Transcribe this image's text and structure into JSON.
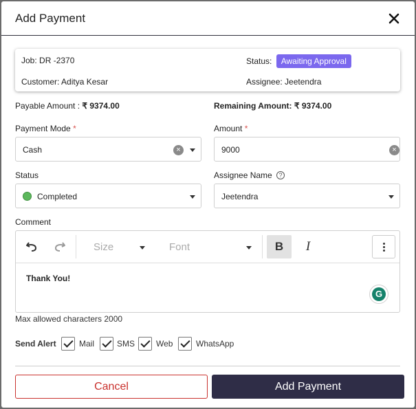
{
  "header": {
    "title": "Add Payment"
  },
  "job": {
    "job_label": "Job:",
    "job_value": "DR -2370",
    "status_label": "Status:",
    "status_value": "Awaiting Approval",
    "customer_label": "Customer:",
    "customer_value": "Aditya Kesar",
    "assignee_label": "Assignee:",
    "assignee_value": "Jeetendra"
  },
  "amounts": {
    "payable_label": "Payable Amount :",
    "payable_value": "₹ 9374.00",
    "remaining_label": "Remaining Amount:",
    "remaining_value": "₹ 9374.00"
  },
  "form": {
    "payment_mode_label": "Payment Mode",
    "payment_mode_value": "Cash",
    "amount_label": "Amount",
    "amount_value": "9000",
    "required_marker": "*",
    "status_label": "Status",
    "status_value": "Completed",
    "assignee_label": "Assignee Name",
    "assignee_value": "Jeetendra",
    "comment_label": "Comment"
  },
  "editor": {
    "size_label": "Size",
    "font_label": "Font",
    "bold_label": "B",
    "italic_label": "I",
    "text": "Thank You!",
    "max_chars_hint": "Max allowed characters 2000"
  },
  "alerts": {
    "label": "Send Alert",
    "options": [
      {
        "label": "Mail",
        "checked": true
      },
      {
        "label": "SMS",
        "checked": true
      },
      {
        "label": "Web",
        "checked": true
      },
      {
        "label": "WhatsApp",
        "checked": true
      }
    ]
  },
  "buttons": {
    "cancel": "Cancel",
    "submit": "Add Payment"
  },
  "colors": {
    "status_badge": "#7b68ee",
    "completed_dot": "#5cb85c",
    "cancel": "#c9302c",
    "primary": "#2f2d47",
    "grammarly": "#15826b"
  },
  "icons": [
    "close-icon",
    "undo-icon",
    "redo-icon",
    "more-vertical-icon",
    "help-icon",
    "grammarly-icon",
    "chevron-down-icon",
    "clear-icon",
    "check-icon"
  ]
}
